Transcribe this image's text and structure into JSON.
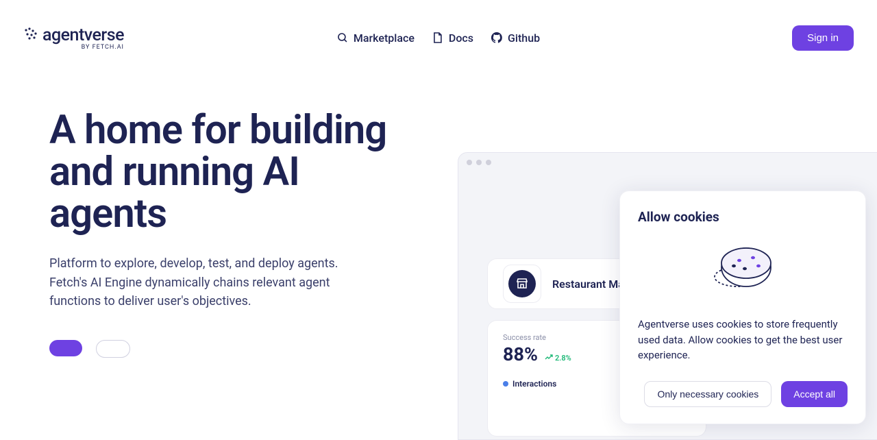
{
  "logo": {
    "brand": "agentverse",
    "byline": "BY FETCH.AI"
  },
  "nav": {
    "marketplace": "Marketplace",
    "docs": "Docs",
    "github": "Github"
  },
  "sign_in": "Sign in",
  "hero": {
    "title": "A home for building and running AI agents",
    "subtitle": "Platform to explore, develop, test, and deploy agents. Fetch's AI Engine dynamically chains relevant agent functions to deliver user's objectives."
  },
  "dashboard": {
    "agent_name": "Restaurant Man",
    "stat_label": "Success rate",
    "stat_value": "88%",
    "stat_change": "2.8%",
    "legend_label": "Interactions"
  },
  "cookie": {
    "title": "Allow cookies",
    "text": "Agentverse uses cookies to store frequently used data. Allow cookies to get the best user experience.",
    "necessary": "Only necessary cookies",
    "accept": "Accept all"
  }
}
